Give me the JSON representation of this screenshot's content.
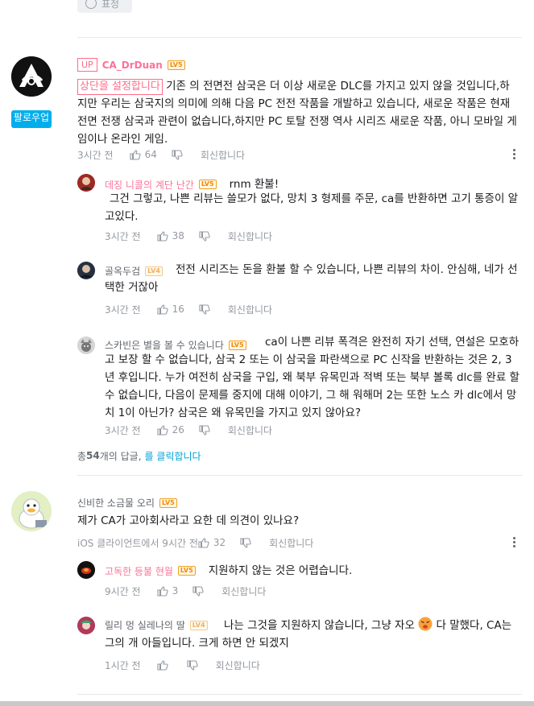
{
  "top": {
    "emoji_label": "표정"
  },
  "comments": [
    {
      "author": "CA_DrDuan",
      "up_badge": "UP",
      "level": "LV5",
      "follow_label": "팔로우업",
      "pinned_label": "상단을 설정합니다",
      "text": "기존 의 전면전 삼국은 더 이상 새로운 DLC를 가지고 있지 않을 것입니다,하지만 우리는 삼국지의 의미에 의해 다음 PC 전전 작품을 개발하고 있습니다, 새로운 작품은 현재 전면 전쟁 삼국과 관련이 없습니다,하지만 PC 토탈 전쟁 역사 시리즈 새로운 작품, 아니 모바일 게임이나 온라인 게임.",
      "time": "3시간 전",
      "likes": "64",
      "reply_label": "회신합니다",
      "replies": [
        {
          "author": "데징 니콜의 계단 난간",
          "level": "LV5",
          "text": "rnm 환불!",
          "text2": "그건 그렇고, 나쁜 리뷰는 쓸모가 없다, 망치 3 형제를 주문, ca를 반환하면 고기 통증이 알고있다.",
          "time": "3시간 전",
          "likes": "38",
          "reply_label": "회신합니다"
        },
        {
          "author": "골옥두검",
          "level": "LV4",
          "text": "전전 시리즈는 돈을 환불 할 수 있습니다, 나쁜 리뷰의 차이. 안심해, 네가 선택한 거잖아",
          "time": "3시간 전",
          "likes": "16",
          "reply_label": "회신합니다"
        },
        {
          "author": "스카빈은 별을 볼 수 있습니다",
          "level": "LV5",
          "text": "ca이 나쁜 리뷰 폭격은 완전히 자기 선택, 연설은 모호하고 보장 할 수 없습니다, 삼국 2 또는 이 삼국을 파란색으로 PC 신작을 반환하는 것은 2, 3 년 후입니다. 누가 여전히 삼국을 구입, 왜 북부 유목민과 적벽 또는 북부 볼록 dlc를 완료 할 수 없습니다, 다음이 문제를 중지에 대해 이야기, 그 해 워해머 2는 또한 노스 카 dlc에서 망치 1이 아닌가? 삼국은 왜 유목민을 가지고 있지 않아요?",
          "time": "3시간 전",
          "likes": "26",
          "reply_label": "회신합니다"
        }
      ],
      "more_replies": {
        "prefix": "총 ",
        "count": "54",
        "suffix": "개의 답글, ",
        "link": "를 클릭합니다"
      }
    },
    {
      "author": "신비한 소금물 오리",
      "level": "LV5",
      "text": "제가 CA가 고아회사라고 요한 데 의견이 있나요?",
      "time": "iOS 클라이언트에서 9시간 전",
      "likes": "32",
      "reply_label": "회신합니다",
      "replies": [
        {
          "author": "고독한 등불 현월",
          "level": "LV5",
          "text": "지원하지 않는 것은 어렵습니다.",
          "time": "9시간 전",
          "likes": "3",
          "reply_label": "회신합니다"
        },
        {
          "author": "릴리 멍 실레나의 딸",
          "level": "LV4",
          "text": "나는 그것을 지원하지 않습니다, 그냥 자오 ",
          "text_after": " 다 말했다, CA는 그의 개 아들입니다. 크게 하면 안 되겠지",
          "time": "1시간 전",
          "likes": "",
          "reply_label": "회신합니다"
        }
      ]
    }
  ]
}
